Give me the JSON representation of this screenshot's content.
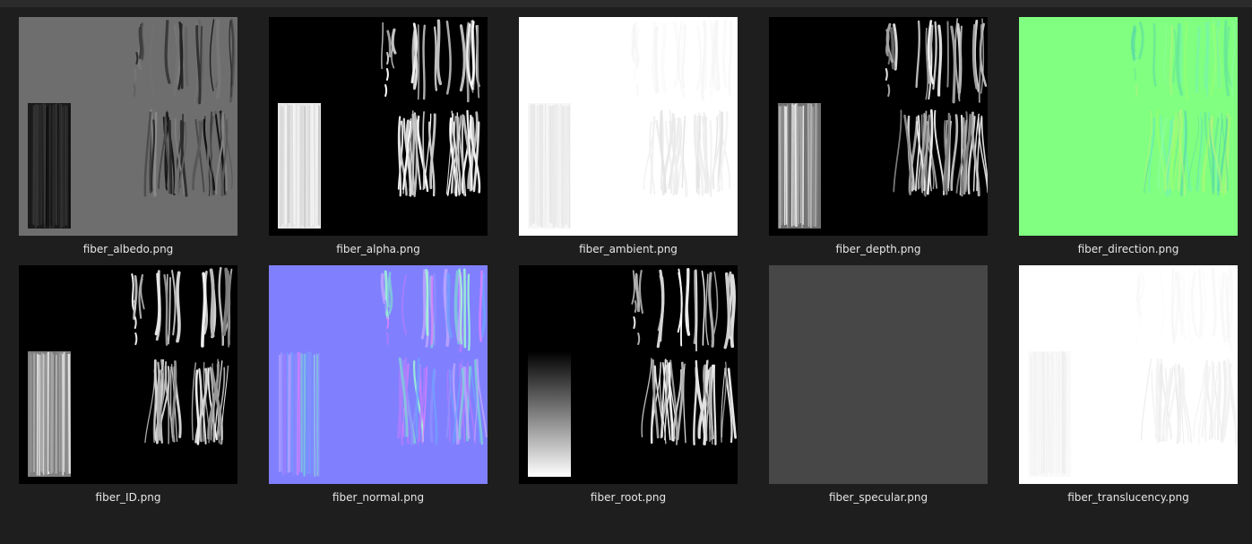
{
  "files": [
    {
      "name": "fiber_albedo.png",
      "kind": "albedo"
    },
    {
      "name": "fiber_alpha.png",
      "kind": "alpha"
    },
    {
      "name": "fiber_ambient.png",
      "kind": "ambient"
    },
    {
      "name": "fiber_depth.png",
      "kind": "depth"
    },
    {
      "name": "fiber_direction.png",
      "kind": "direction"
    },
    {
      "name": "fiber_ID.png",
      "kind": "id"
    },
    {
      "name": "fiber_normal.png",
      "kind": "normal"
    },
    {
      "name": "fiber_root.png",
      "kind": "root"
    },
    {
      "name": "fiber_specular.png",
      "kind": "specular"
    },
    {
      "name": "fiber_translucency.png",
      "kind": "translucency"
    }
  ],
  "colors": {
    "background": "#1e1e1e",
    "topbar": "#2b2b2b",
    "label": "#e6e6e6",
    "albedo_bg": "#6e6e6e",
    "direction_bg": "#80ff80",
    "normal_bg": "#8080ff",
    "specular_bg": "#474747"
  }
}
